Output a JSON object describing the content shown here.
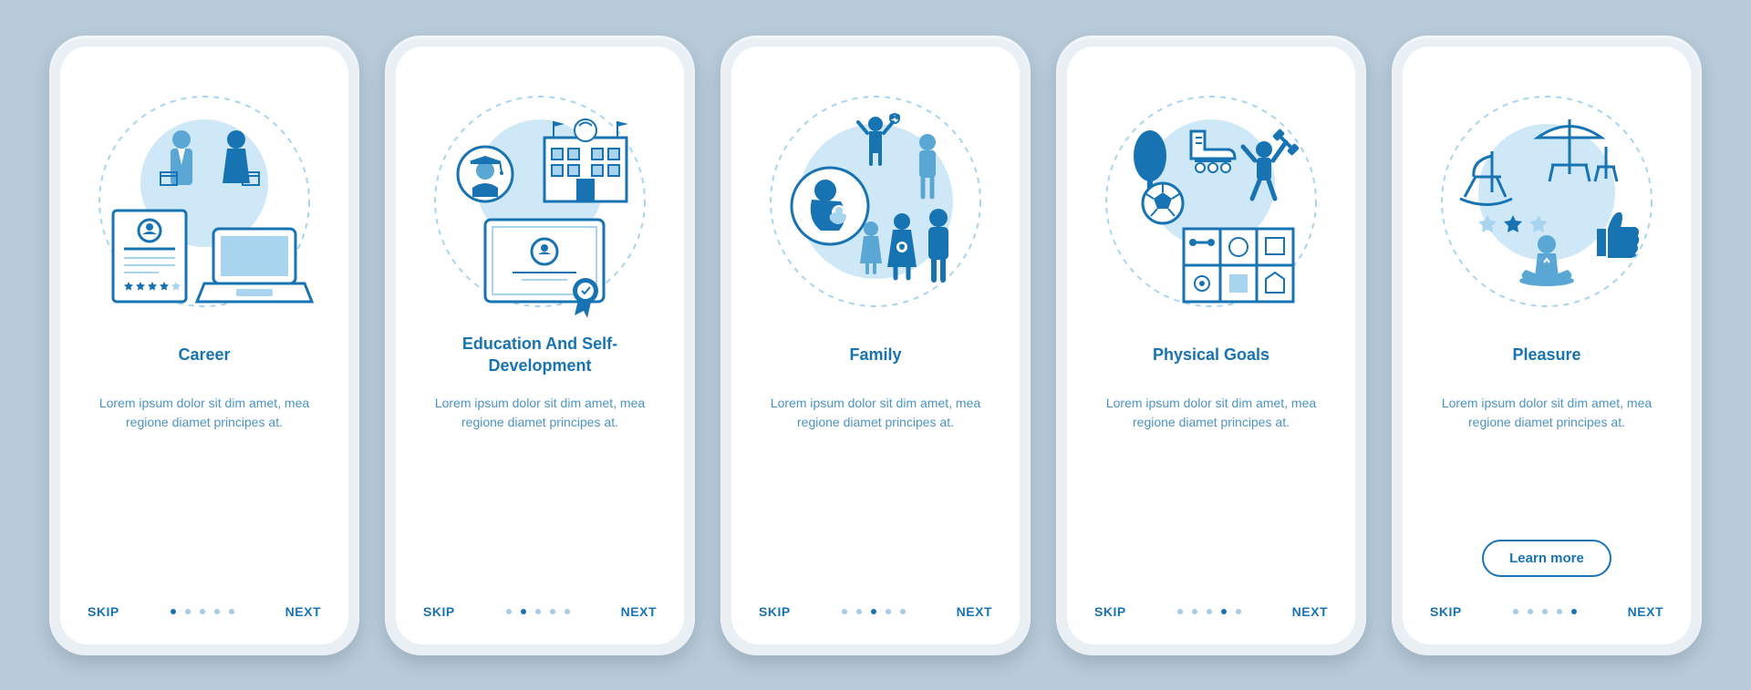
{
  "common": {
    "skip": "SKIP",
    "next": "NEXT",
    "total_dots": 5,
    "learn_more": "Learn more"
  },
  "screens": [
    {
      "title": "Career",
      "desc": "Lorem ipsum dolor sit dim amet, mea regione diamet principes at.",
      "active_dot": 0,
      "has_learn": false
    },
    {
      "title": "Education And Self-Development",
      "desc": "Lorem ipsum dolor sit dim amet, mea regione diamet principes at.",
      "active_dot": 1,
      "has_learn": false
    },
    {
      "title": "Family",
      "desc": "Lorem ipsum dolor sit dim amet, mea regione diamet principes at.",
      "active_dot": 2,
      "has_learn": false
    },
    {
      "title": "Physical Goals",
      "desc": "Lorem ipsum dolor sit dim amet, mea regione diamet principes at.",
      "active_dot": 3,
      "has_learn": false
    },
    {
      "title": "Pleasure",
      "desc": "Lorem ipsum dolor sit dim amet, mea regione diamet principes at.",
      "active_dot": 4,
      "has_learn": true
    }
  ],
  "colors": {
    "primary": "#1873b3",
    "light": "#a8d4f0",
    "bg_circle": "#cfe8f7",
    "white": "#ffffff"
  }
}
